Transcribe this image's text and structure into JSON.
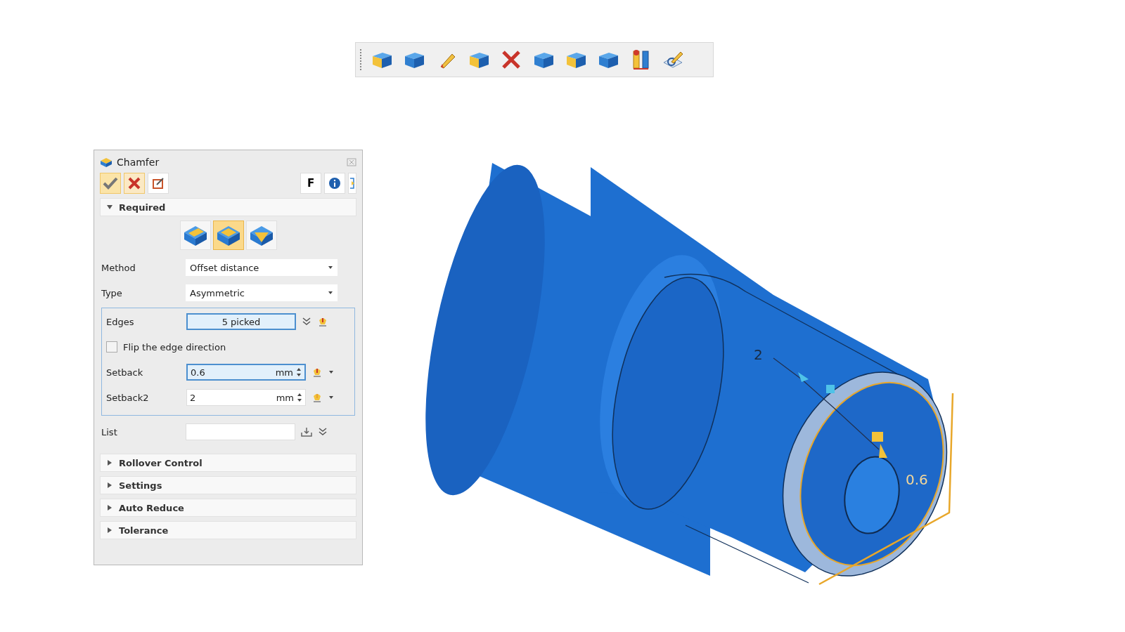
{
  "dialog": {
    "title": "Chamfer",
    "f_button": "F",
    "sections": [
      {
        "title": "Required",
        "expanded": true
      },
      {
        "title": "Rollover Control",
        "expanded": false
      },
      {
        "title": "Settings",
        "expanded": false
      },
      {
        "title": "Auto Reduce",
        "expanded": false
      },
      {
        "title": "Tolerance",
        "expanded": false
      }
    ],
    "chamfer_types": [
      {
        "kind": "wedge",
        "selected": false
      },
      {
        "kind": "flat",
        "selected": true
      },
      {
        "kind": "vertex",
        "selected": false
      }
    ],
    "method": {
      "label": "Method",
      "value": "Offset distance"
    },
    "type": {
      "label": "Type",
      "value": "Asymmetric"
    },
    "edges": {
      "label": "Edges",
      "value": "5 picked",
      "active": true
    },
    "flip": {
      "label": "Flip the edge direction",
      "checked": false
    },
    "setbacks": [
      {
        "label": "Setback",
        "value": "0.6",
        "unit": "mm",
        "active": true
      },
      {
        "label": "Setback2",
        "value": "2",
        "unit": "mm",
        "active": false
      }
    ],
    "list": {
      "label": "List"
    }
  },
  "viewport": {
    "dimension_labels": [
      "2",
      "0.6"
    ]
  }
}
